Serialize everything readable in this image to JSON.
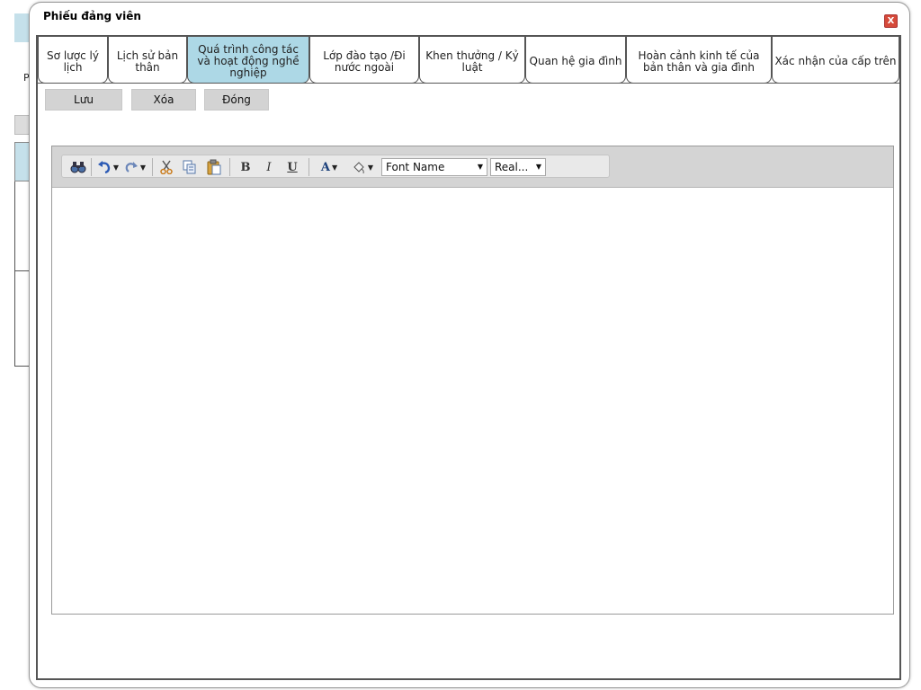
{
  "dialog": {
    "title": "Phiếu đảng viên",
    "close_label": "X"
  },
  "tabs": [
    {
      "label": "Sơ lược lý lịch",
      "active": false
    },
    {
      "label": "Lịch sử bản thân",
      "active": false
    },
    {
      "label": "Quá trình công tác và hoạt động nghề nghiệp",
      "active": true
    },
    {
      "label": "Lớp đào tạo /Đi nước ngoài",
      "active": false
    },
    {
      "label": "Khen thưởng / Kỷ luật",
      "active": false
    },
    {
      "label": "Quan hệ gia đình",
      "active": false
    },
    {
      "label": "Hoàn cảnh kinh tế của bản thân và gia đình",
      "active": false
    },
    {
      "label": "Xác nhận của cấp trên",
      "active": false
    }
  ],
  "actions": {
    "save": "Lưu",
    "delete": "Xóa",
    "close": "Đóng"
  },
  "editor": {
    "font_name": "Font Name",
    "font_size": "Real...",
    "bold": "B",
    "italic": "I",
    "underline": "U",
    "font_color": "A",
    "icons": [
      "find-icon",
      "undo-icon",
      "redo-icon",
      "cut-icon",
      "copy-icon",
      "paste-icon",
      "bold-icon",
      "italic-icon",
      "underline-icon",
      "font-color-icon",
      "highlight-icon"
    ]
  },
  "background": {
    "letter": "P"
  }
}
